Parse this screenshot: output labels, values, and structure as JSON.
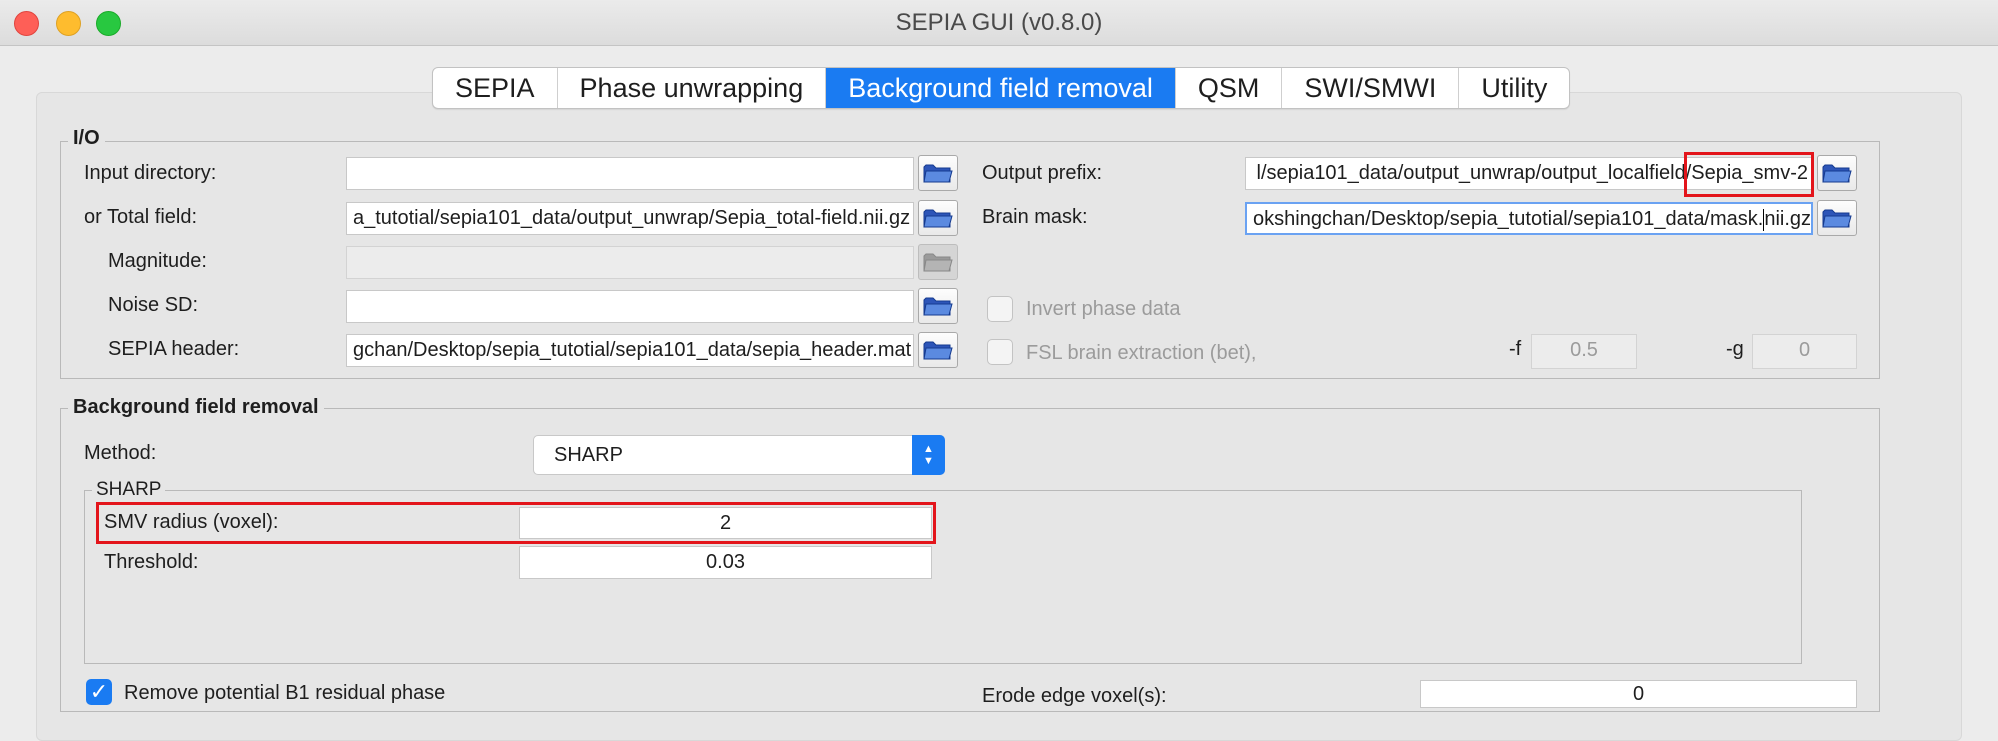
{
  "window": {
    "title": "SEPIA GUI (v0.8.0)"
  },
  "tabs": [
    {
      "label": "SEPIA"
    },
    {
      "label": "Phase unwrapping"
    },
    {
      "label": "Background field removal"
    },
    {
      "label": "QSM"
    },
    {
      "label": "SWI/SMWI"
    },
    {
      "label": "Utility"
    }
  ],
  "io": {
    "title": "I/O",
    "input_directory": {
      "label": "Input directory:",
      "value": ""
    },
    "total_field": {
      "label": "or Total field:",
      "value": "a_tutotial/sepia101_data/output_unwrap/Sepia_total-field.nii.gz"
    },
    "magnitude": {
      "label": "Magnitude:",
      "value": ""
    },
    "noise_sd": {
      "label": "Noise SD:",
      "value": ""
    },
    "sepia_header": {
      "label": "SEPIA header:",
      "value": "gchan/Desktop/sepia_tutotial/sepia101_data/sepia_header.mat"
    },
    "output_prefix": {
      "label": "Output prefix:",
      "value_path": "l/sepia101_data/output_unwrap/output_localfield/",
      "value_name": "Sepia_smv-2"
    },
    "brain_mask": {
      "label": "Brain mask:",
      "value_before_cursor": "okshingchan/Desktop/sepia_tutotial/sepia101_data/mask.",
      "value_after_cursor": "nii.gz"
    },
    "invert_phase": {
      "label": "Invert phase data",
      "checked": false
    },
    "fsl_bet": {
      "label": "FSL brain extraction (bet),",
      "checked": false
    },
    "bet_f": {
      "label": "-f",
      "value": "0.5"
    },
    "bet_g": {
      "label": "-g",
      "value": "0"
    }
  },
  "bfr": {
    "title": "Background field removal",
    "method": {
      "label": "Method:",
      "value": "SHARP"
    },
    "sharp": {
      "title": "SHARP",
      "smv_radius": {
        "label": "SMV radius (voxel):",
        "value": "2"
      },
      "threshold": {
        "label": "Threshold:",
        "value": "0.03"
      }
    },
    "remove_b1": {
      "label": "Remove potential B1 residual phase",
      "checked": true,
      "check_mark": "✓"
    },
    "erode_edge": {
      "label": "Erode edge voxel(s):",
      "value": "0"
    }
  },
  "colors": {
    "accent": "#1a7bf2",
    "highlight": "#e3151b",
    "close": "#fe5f57",
    "minimize": "#febc2e",
    "zoom": "#28c840"
  }
}
